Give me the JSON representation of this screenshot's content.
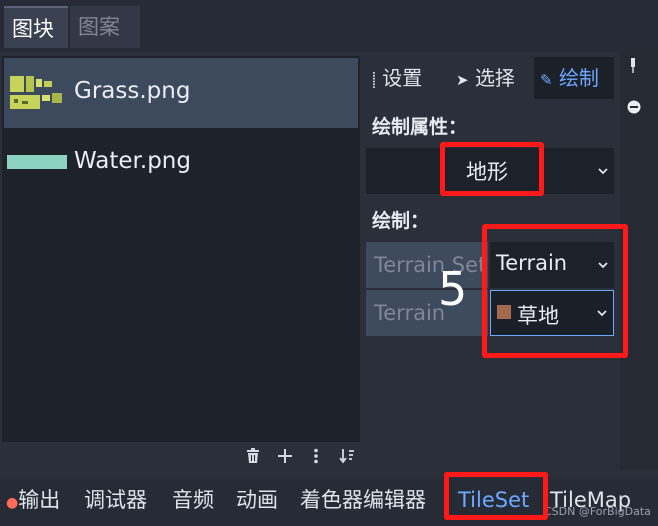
{
  "top_tabs": {
    "tiles": "图块",
    "patterns": "图案"
  },
  "tile_list": [
    {
      "name": "Grass.png"
    },
    {
      "name": "Water.png"
    }
  ],
  "right_tabs": {
    "settings": "设置",
    "select": "选择",
    "paint": "绘制"
  },
  "paint_properties": {
    "heading": "绘制属性：",
    "selected": "地形"
  },
  "paint": {
    "heading": "绘制：",
    "terrain_set_label": "Terrain Set",
    "terrain_set_value": "Terrain",
    "terrain_label": "Terrain",
    "terrain_value": "草地",
    "terrain_color": "#a36a4f"
  },
  "annotation_number": "5",
  "bottom_tabs": {
    "output": "输出",
    "debugger": "调试器",
    "audio": "音频",
    "animation": "动画",
    "shader_editor": "着色器编辑器",
    "tileset": "TileSet",
    "tilemap": "TileMap"
  },
  "watermark": "CSDN @ForBigData",
  "colors": {
    "accent": "#6fa8ff",
    "highlight": "#ff1a1a"
  }
}
